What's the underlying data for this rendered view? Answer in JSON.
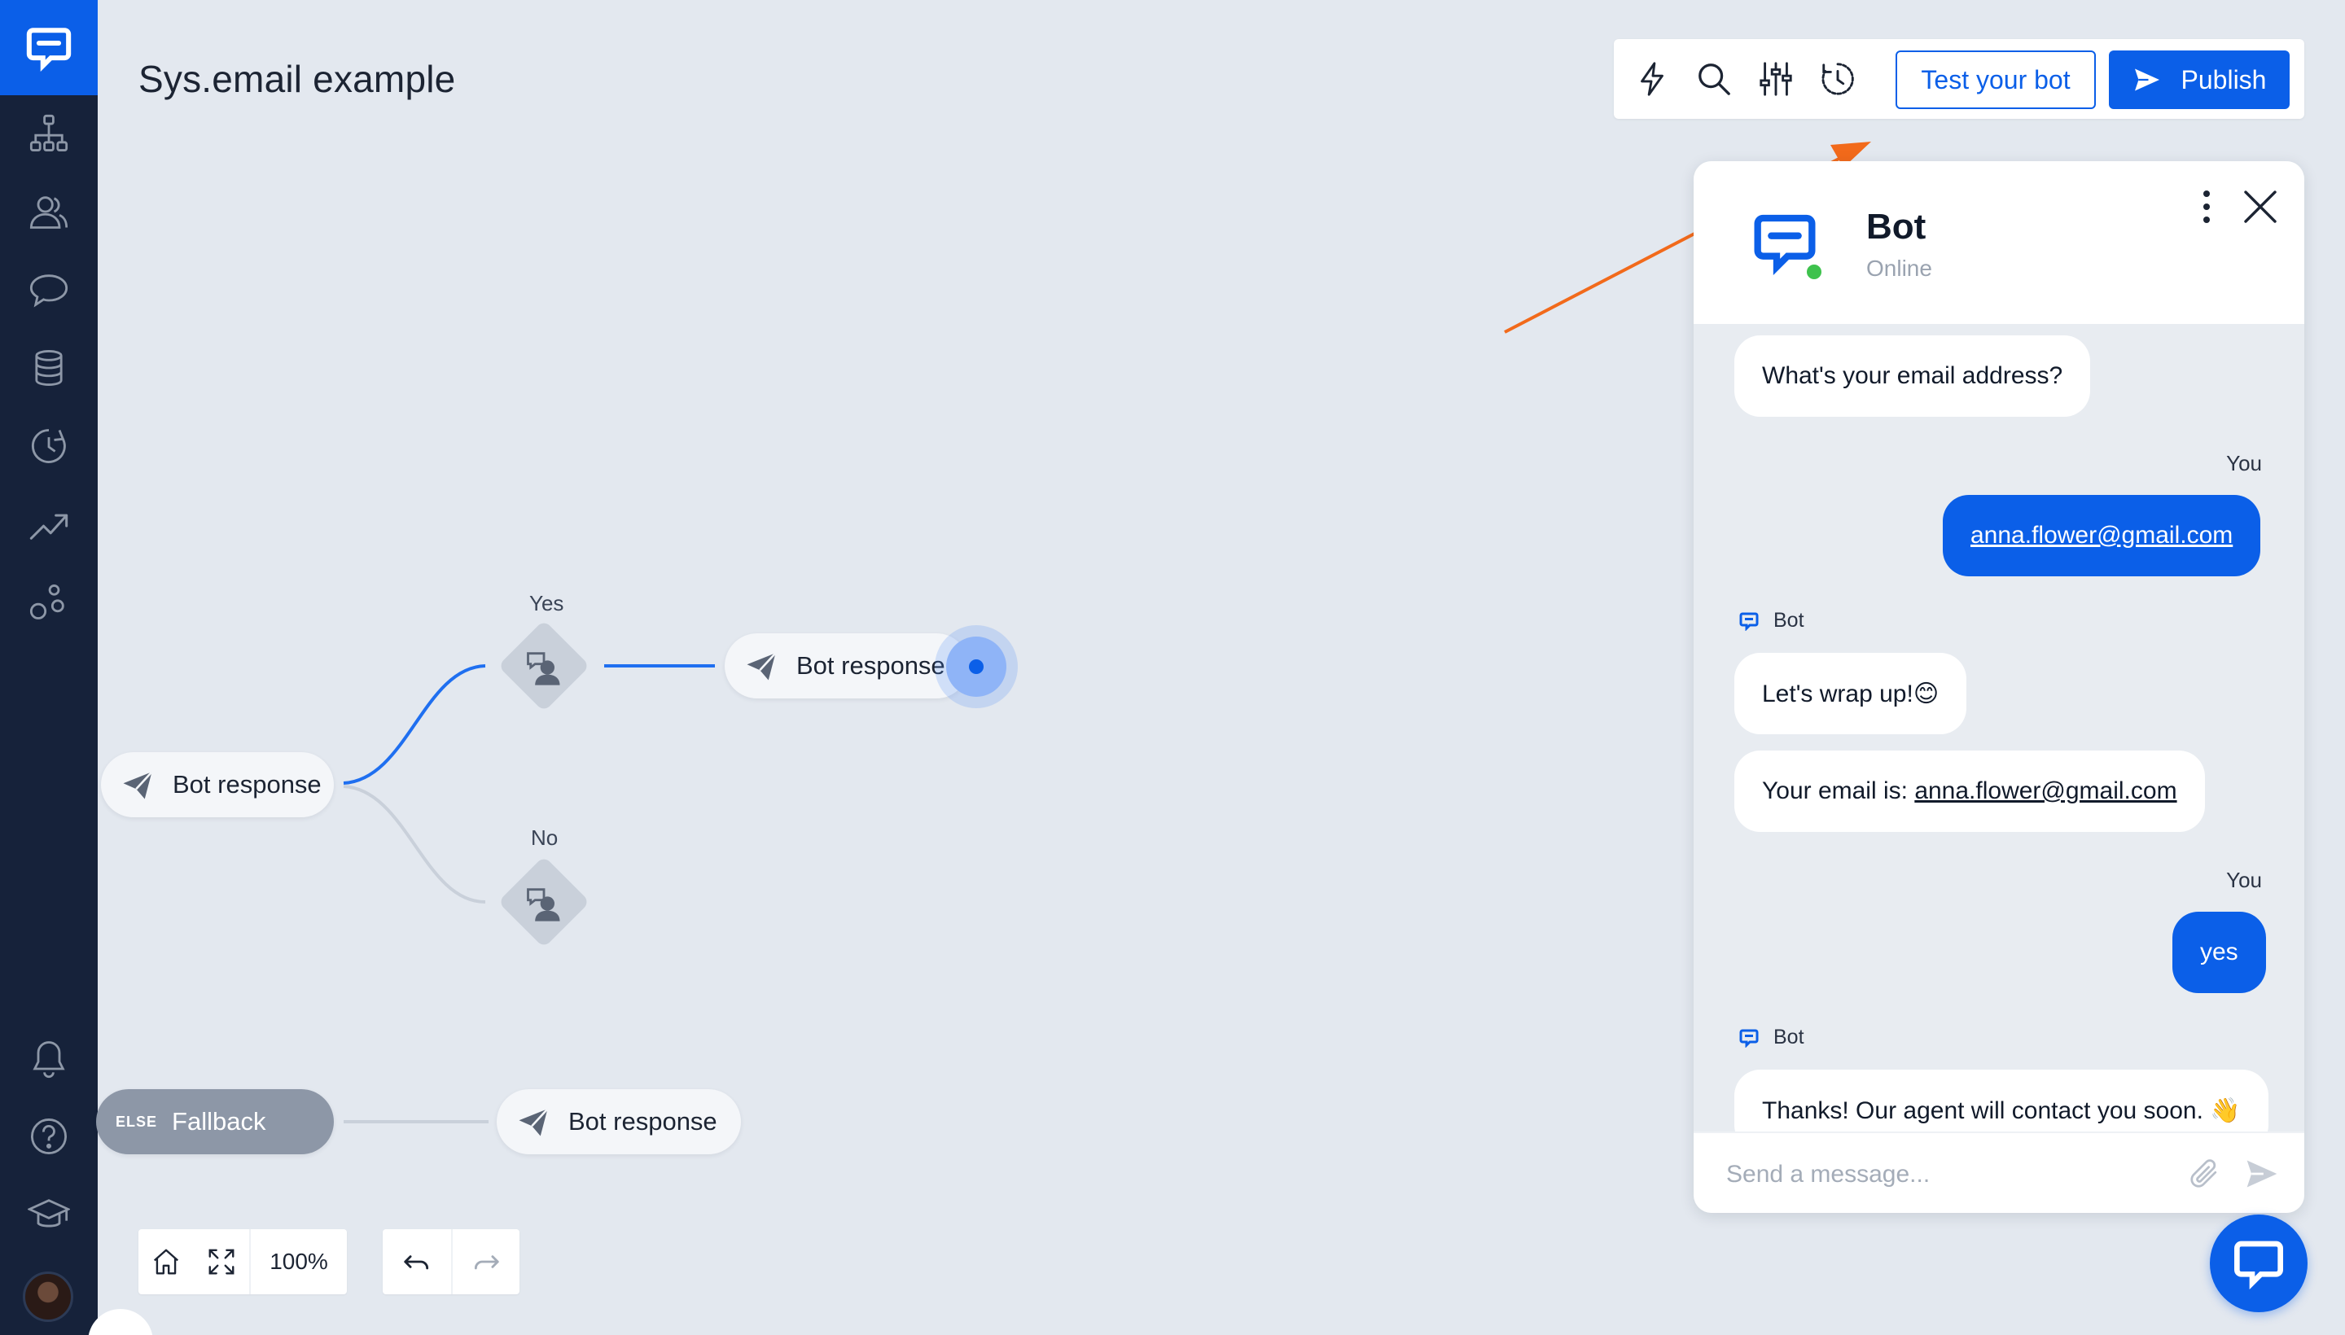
{
  "page": {
    "title": "Sys.email example"
  },
  "toolbar": {
    "icons": [
      "lightning-icon",
      "search-icon",
      "sliders-icon",
      "history-icon"
    ],
    "test_label": "Test your bot",
    "publish_label": "Publish"
  },
  "sidebar": {
    "items": [
      "flow-icon",
      "users-icon",
      "chat-bubbles-icon",
      "database-icon",
      "clock-icon",
      "trend-icon",
      "bubbles-icon"
    ],
    "bottom": [
      "bell-icon",
      "help-icon",
      "graduation-icon"
    ]
  },
  "flow": {
    "root_label": "Bot response",
    "yes_label": "Yes",
    "no_label": "No",
    "response_label": "Bot response",
    "fallback_tag": "ELSE",
    "fallback_label": "Fallback",
    "fallback_response_label": "Bot response"
  },
  "zoom": {
    "level": "100%"
  },
  "chat": {
    "bot_name": "Bot",
    "status": "Online",
    "you_label": "You",
    "bot_label": "Bot",
    "messages": {
      "q_email": "What's your email address?",
      "user_email": "anna.flower@gmail.com",
      "wrap_up": "Let's wrap up!😊",
      "email_prefix": "Your email is: ",
      "email_value": "anna.flower@gmail.com",
      "user_yes": "yes",
      "thanks": "Thanks! Our agent will contact you soon. 👋"
    },
    "composer_placeholder": "Send a message..."
  },
  "colors": {
    "accent": "#0b5fe8",
    "sidebar": "#16223a",
    "canvas": "#e3e8ef",
    "annotation_arrow": "#f26a1b",
    "online": "#3ec24d"
  }
}
